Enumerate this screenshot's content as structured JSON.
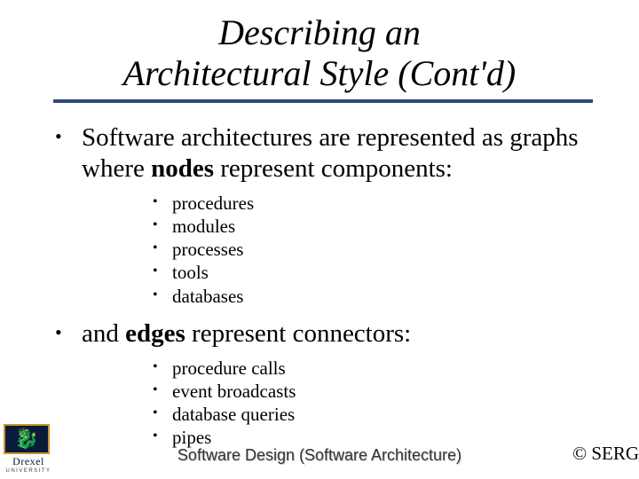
{
  "title_line1": "Describing an",
  "title_line2": "Architectural Style (Cont'd)",
  "bullet1_pre": "Software architectures are represented as graphs where ",
  "bullet1_bold": "nodes",
  "bullet1_post": " represent components:",
  "nodes": [
    "procedures",
    "modules",
    "processes",
    "tools",
    "databases"
  ],
  "bullet2_pre": "and ",
  "bullet2_bold": "edges",
  "bullet2_post": " represent connectors:",
  "edges": [
    "procedure calls",
    "event broadcasts",
    "database queries",
    "pipes"
  ],
  "logo": {
    "name": "Drexel",
    "sub": "UNIVERSITY"
  },
  "footer_center": "Software Design (Software Architecture)",
  "footer_right": "© SERG"
}
